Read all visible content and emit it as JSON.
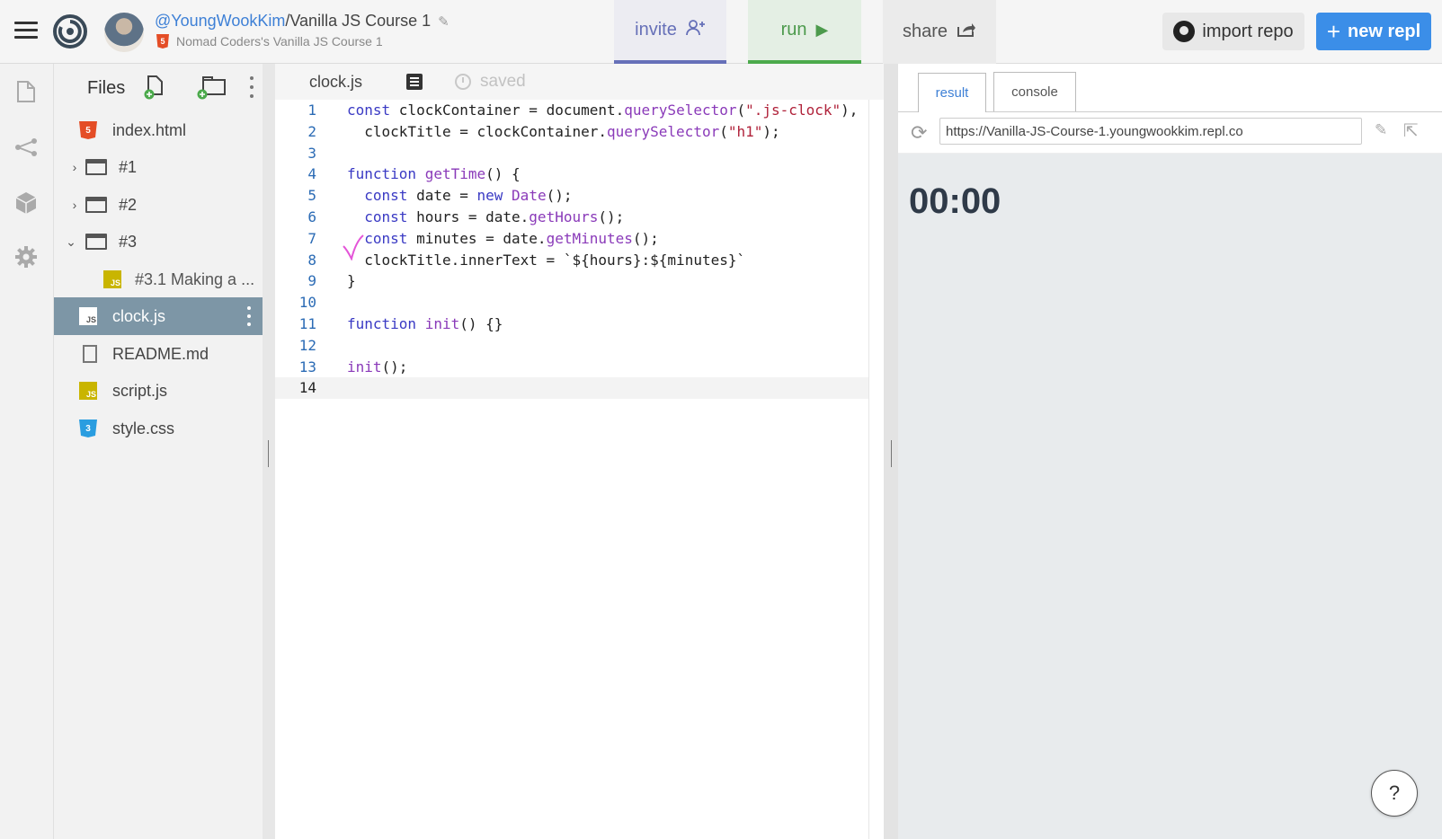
{
  "header": {
    "menu_icon": "hamburger-icon",
    "logo_icon": "repl-logo-icon",
    "username": "@YoungWookKim",
    "separator": "/",
    "repl_name": "Vanilla JS Course 1",
    "subtitle": "Nomad Coders's Vanilla JS Course 1",
    "badge_text": "5",
    "invite_label": "invite",
    "invite_icon": "add-user-icon",
    "run_label": "run",
    "run_icon": "play-icon",
    "share_label": "share",
    "share_icon": "share-icon",
    "import_label": "import repo",
    "new_label": "new repl",
    "colors": {
      "invite": "#6670b8",
      "run": "#4caa4c",
      "new": "#3b8ee8"
    }
  },
  "rail": {
    "items": [
      "files-icon",
      "version-control-icon",
      "packages-icon",
      "settings-icon"
    ]
  },
  "files": {
    "title": "Files",
    "items": [
      {
        "name": "index.html",
        "icon": "html-file-icon",
        "icon_text": "5"
      },
      {
        "name": "#1",
        "icon": "folder-icon",
        "chevron": "›"
      },
      {
        "name": "#2",
        "icon": "folder-icon",
        "chevron": "›"
      },
      {
        "name": "#3",
        "icon": "folder-icon",
        "chevron": "⌄"
      },
      {
        "name": "#3.1 Making a ...",
        "icon": "js-file-icon",
        "icon_text": "JS"
      },
      {
        "name": "clock.js",
        "icon": "js-file-icon",
        "icon_text": "JS",
        "active": true
      },
      {
        "name": "README.md",
        "icon": "document-icon"
      },
      {
        "name": "script.js",
        "icon": "js-file-icon",
        "icon_text": "JS"
      },
      {
        "name": "style.css",
        "icon": "css-file-icon",
        "icon_text": "3"
      }
    ]
  },
  "editor": {
    "tab_label": "clock.js",
    "saved_label": "saved",
    "line_numbers": [
      "1",
      "2",
      "3",
      "4",
      "5",
      "6",
      "7",
      "8",
      "9",
      "10",
      "11",
      "12",
      "13",
      "14"
    ],
    "lines": [
      "const clockContainer = document.querySelector(\".js-clock\"),",
      "  clockTitle = clockContainer.querySelector(\"h1\");",
      "",
      "function getTime() {",
      "  const date = new Date();",
      "  const hours = date.getHours();",
      "  const minutes = date.getMinutes();",
      "  clockTitle.innerText = `${hours}:${minutes}`",
      "}",
      "",
      "function init() {}",
      "",
      "init();",
      ""
    ],
    "current_line": "14"
  },
  "result": {
    "tabs": [
      "result",
      "console"
    ],
    "active_tab": "result",
    "url": "https://Vanilla-JS-Course-1.youngwookkim.repl.co",
    "clock_text": "00:00"
  },
  "help": {
    "label": "?"
  }
}
